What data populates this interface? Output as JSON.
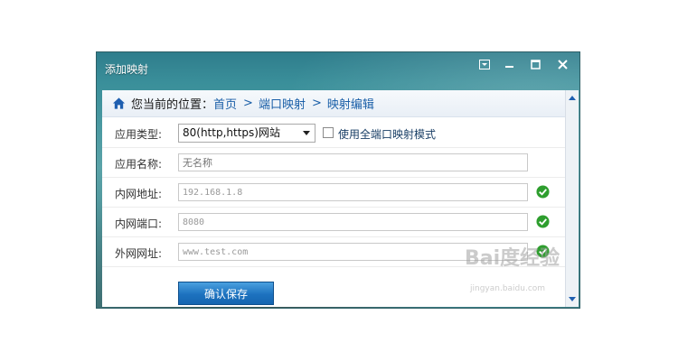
{
  "window": {
    "title": "添加映射"
  },
  "breadcrumb": {
    "prefix": "您当前的位置：",
    "items": [
      "首页",
      "端口映射",
      "映射编辑"
    ],
    "separator": ">"
  },
  "form": {
    "app_type": {
      "label": "应用类型:",
      "selected": "80(http,https)网站",
      "checkbox_label": "使用全端口映射模式",
      "checkbox_checked": false
    },
    "app_name": {
      "label": "应用名称:",
      "placeholder": "无名称"
    },
    "lan_address": {
      "label": "内网地址:",
      "value": "192.168.1.8"
    },
    "lan_port": {
      "label": "内网端口:",
      "value": "8080"
    },
    "wan_address": {
      "label": "外网网址:",
      "value": "www.test.com"
    },
    "save_label": "确认保存"
  },
  "watermark": {
    "brand": "Bai度经验",
    "url": "jingyan.baidu.com"
  },
  "colors": {
    "accent": "#1d72bf",
    "valid": "#2e9e2e",
    "link": "#1a5fa8"
  }
}
